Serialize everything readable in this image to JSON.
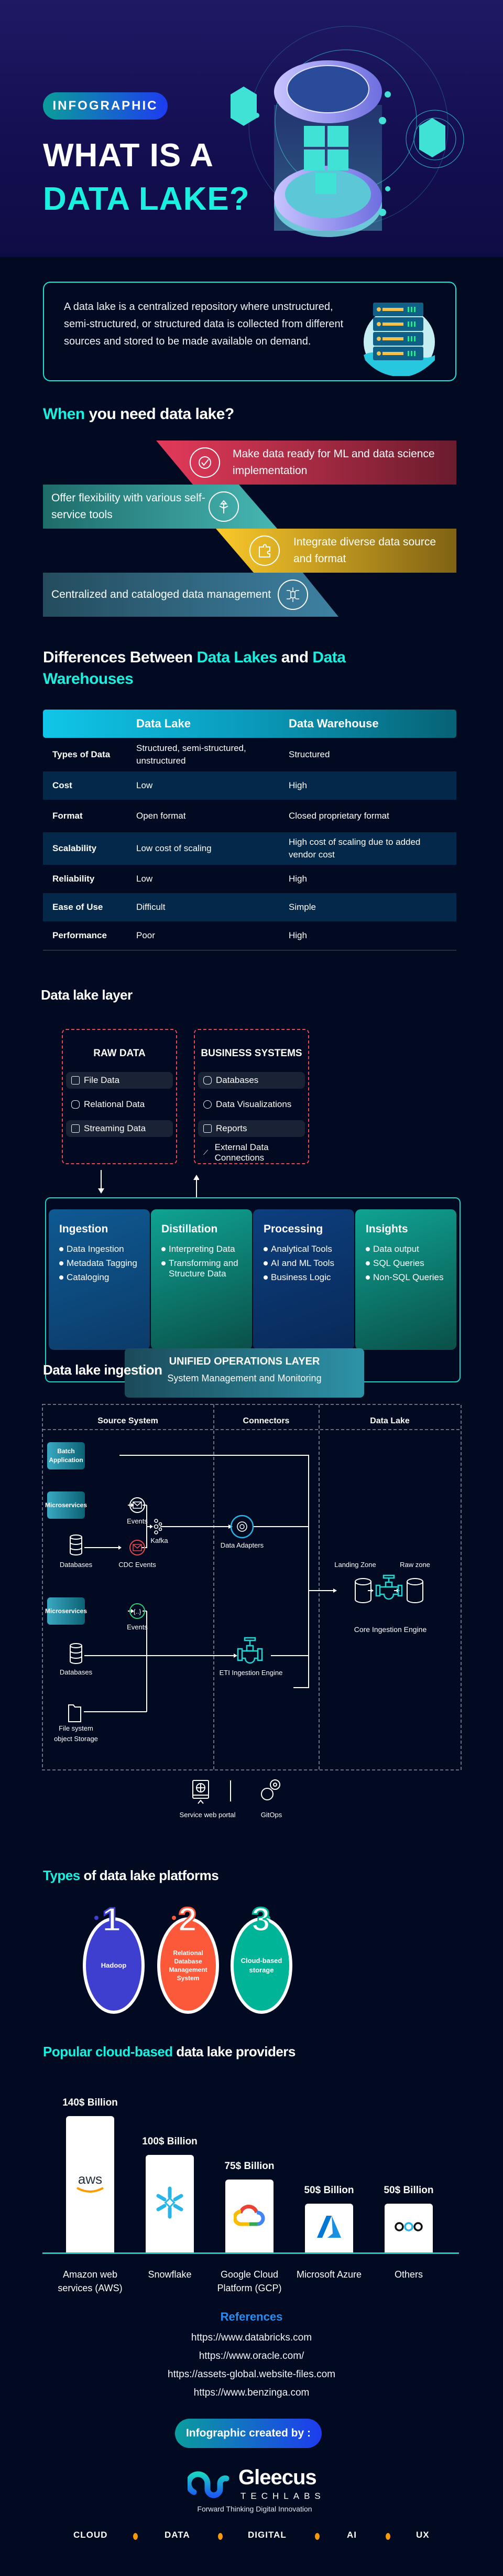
{
  "hero": {
    "badge": "INFOGRAPHIC",
    "title_line1": "WHAT IS A",
    "title_line2": "DATA LAKE?"
  },
  "intro": {
    "text": "A data lake is a centralized repository where unstructured, semi-structured, or structured data is collected from different sources and stored to be made available on demand.",
    "icon": "server-rack-icon"
  },
  "when": {
    "title_accent": "When",
    "title_rest": " you need data lake?",
    "items": [
      {
        "text": "Make data ready for ML and data science implementation",
        "icon": "check-circle-icon",
        "color": "#d83a56"
      },
      {
        "text": "Offer flexibility with various self-service tools",
        "icon": "split-arrows-icon",
        "color": "#2f9d9a"
      },
      {
        "text": "Integrate diverse data source and format",
        "icon": "puzzle-icon",
        "color": "#e8b422"
      },
      {
        "text": "Centralized and cataloged data management",
        "icon": "database-network-icon",
        "color": "#356c88"
      }
    ]
  },
  "differences": {
    "title_part1": "Differences Between ",
    "title_accent1": "Data Lakes",
    "title_part2": " and ",
    "title_accent2": "Data Warehouses",
    "headers": [
      "",
      "Data Lake",
      "Data Warehouse"
    ],
    "rows": [
      {
        "aspect": "Types of Data",
        "lake": "Structured, semi-structured, unstructured",
        "warehouse": "Structured"
      },
      {
        "aspect": "Cost",
        "lake": "Low",
        "warehouse": "High"
      },
      {
        "aspect": "Format",
        "lake": "Open format",
        "warehouse": "Closed proprietary format"
      },
      {
        "aspect": "Scalability",
        "lake": "Low cost of scaling",
        "warehouse": "High cost of scaling due to added vendor cost"
      },
      {
        "aspect": "Reliability",
        "lake": "Low",
        "warehouse": "High"
      },
      {
        "aspect": "Ease of Use",
        "lake": "Difficult",
        "warehouse": "Simple"
      },
      {
        "aspect": "Performance",
        "lake": "Poor",
        "warehouse": "High"
      }
    ]
  },
  "layer": {
    "title": "Data lake layer",
    "raw": {
      "title": "RAW DATA",
      "items": [
        {
          "label": "File Data",
          "icon": "folder-stack-icon"
        },
        {
          "label": "Relational Data",
          "icon": "relational-db-icon"
        },
        {
          "label": "Streaming Data",
          "icon": "streaming-monitor-icon"
        }
      ]
    },
    "business": {
      "title": "BUSINESS SYSTEMS",
      "items": [
        {
          "label": "Databases",
          "icon": "database-icon"
        },
        {
          "label": "Data Visualizations",
          "icon": "visualization-eye-icon"
        },
        {
          "label": "Reports",
          "icon": "report-chart-icon"
        },
        {
          "label": "External Data Connections",
          "icon": "trend-line-icon"
        }
      ]
    },
    "stages": [
      {
        "title": "Ingestion",
        "items": [
          "Data Ingestion",
          "Metadata Tagging",
          "Cataloging"
        ]
      },
      {
        "title": "Distillation",
        "items": [
          "Interpreting Data",
          "Transforming and Structure Data"
        ]
      },
      {
        "title": "Processing",
        "items": [
          "Analytical Tools",
          "AI and ML Tools",
          "Business Logic"
        ]
      },
      {
        "title": "Insights",
        "items": [
          "Data output",
          "SQL Queries",
          "Non-SQL Queries"
        ]
      }
    ],
    "unified": {
      "title": "UNIFIED OPERATIONS LAYER",
      "subtitle": "System Management and Monitoring"
    }
  },
  "ingestion": {
    "title": "Data lake ingestion",
    "columns": [
      "Source System",
      "Connectors",
      "Data Lake"
    ],
    "batch": "Batch Application",
    "micro1": "Microservices",
    "micro2": "Microservices",
    "events1": "Events",
    "events2": "Events",
    "databases1": "Databases",
    "databases2": "Databases",
    "cdc": "CDC Events",
    "kafka": "Kafka",
    "adapters": "Data Adapters",
    "eti": "ETI Ingestion Engine",
    "filesystem_l1": "File system",
    "filesystem_l2": "object Storage",
    "landing": "Landing Zone",
    "raw": "Raw zone",
    "core": "Core Ingestion Engine",
    "portal": "Self Service web portal",
    "gitops": "GitOps"
  },
  "types": {
    "title_accent": "Types",
    "title_rest": " of data lake platforms",
    "items": [
      {
        "number": "1",
        "label": "Hadoop",
        "color": "#3f3fcf"
      },
      {
        "number": "2",
        "label": "Relational Database Management System",
        "color": "#fc583a"
      },
      {
        "number": "3",
        "label": "Cloud-based storage",
        "color": "#00b597"
      }
    ]
  },
  "providers": {
    "title_accent": "Popular cloud-based",
    "title_rest": " data lake providers"
  },
  "chart_data": {
    "type": "bar",
    "title": "Popular cloud-based data lake providers",
    "categories": [
      "Amazon web services (AWS)",
      "Snowflake",
      "Google Cloud Platform (GCP)",
      "Microsoft Azure",
      "Others"
    ],
    "values": [
      140,
      100,
      75,
      50,
      50
    ],
    "value_labels": [
      "140$ Billion",
      "100$ Billion",
      "75$ Billion",
      "50$ Billion",
      "50$ Billion"
    ],
    "unit": "$ Billion",
    "xlabel": "",
    "ylabel": "",
    "grid": false,
    "logos": [
      "aws-logo-icon",
      "snowflake-logo-icon",
      "google-cloud-logo-icon",
      "azure-logo-icon",
      "others-dots-icon"
    ]
  },
  "references": {
    "title": "References",
    "links": [
      "https://www.databricks.com",
      "https://www.oracle.com/",
      "https://assets-global.website-files.com",
      "https://www.benzinga.com"
    ]
  },
  "footer": {
    "created_by": "Infographic created by :",
    "brand": "Gleecus",
    "brand_sub": "TECHLABS",
    "tagline": "Forward Thinking Digital Innovation",
    "services": [
      "CLOUD",
      "DATA",
      "DIGITAL",
      "AI",
      "UX"
    ],
    "dot_color": "#f59a0c"
  }
}
